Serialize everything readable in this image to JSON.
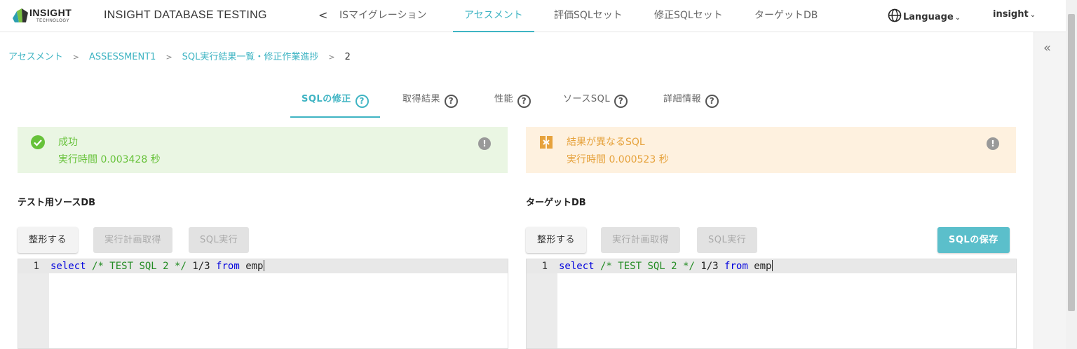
{
  "app": {
    "logo_text": "INSIGHT",
    "logo_subtext": "TECHNOLOGY",
    "title": "INSIGHT DATABASE TESTING"
  },
  "nav": {
    "back_symbol": "<",
    "items": [
      {
        "label": "ISマイグレーション"
      },
      {
        "label": "アセスメント"
      },
      {
        "label": "評価SQLセット"
      },
      {
        "label": "修正SQLセット"
      },
      {
        "label": "ターゲットDB"
      }
    ],
    "active_index": 1,
    "language_label": "Language",
    "user_label": "insight",
    "accent_color": "#3fb4c3"
  },
  "breadcrumb": [
    {
      "label": "アセスメント"
    },
    {
      "label": "ASSESSMENT1"
    },
    {
      "label": "SQL実行結果一覧・修正作業進捗"
    },
    {
      "label": "2"
    }
  ],
  "tabs": [
    {
      "label": "SQLの修正"
    },
    {
      "label": "取得結果"
    },
    {
      "label": "性能"
    },
    {
      "label": "ソースSQL"
    },
    {
      "label": "詳細情報"
    }
  ],
  "status_source": {
    "title": "成功",
    "exec_time": "実行時間 0.003428 秒",
    "color": "#67c23a"
  },
  "status_target": {
    "title": "結果が異なるSQL",
    "exec_time": "実行時間 0.000523 秒",
    "color": "#e6a23c"
  },
  "source_panel": {
    "title": "テスト用ソースDB",
    "buttons": {
      "format": "整形する",
      "plan": "実行計画取得",
      "run": "SQL実行"
    },
    "editor": {
      "line_number": "1",
      "kw_select": "select",
      "comment": "/* TEST SQL 2 */",
      "expr": "1/3",
      "kw_from": "from",
      "table": "emp"
    }
  },
  "target_panel": {
    "title": "ターゲットDB",
    "buttons": {
      "format": "整形する",
      "plan": "実行計画取得",
      "run": "SQL実行",
      "save": "SQLの保存"
    },
    "editor": {
      "line_number": "1",
      "kw_select": "select",
      "comment": "/* TEST SQL 2 */",
      "expr": "1/3",
      "kw_from": "from",
      "table": "emp"
    }
  },
  "side": {
    "collapse_symbol": "«"
  },
  "help_symbol": "?",
  "info_symbol": "!"
}
